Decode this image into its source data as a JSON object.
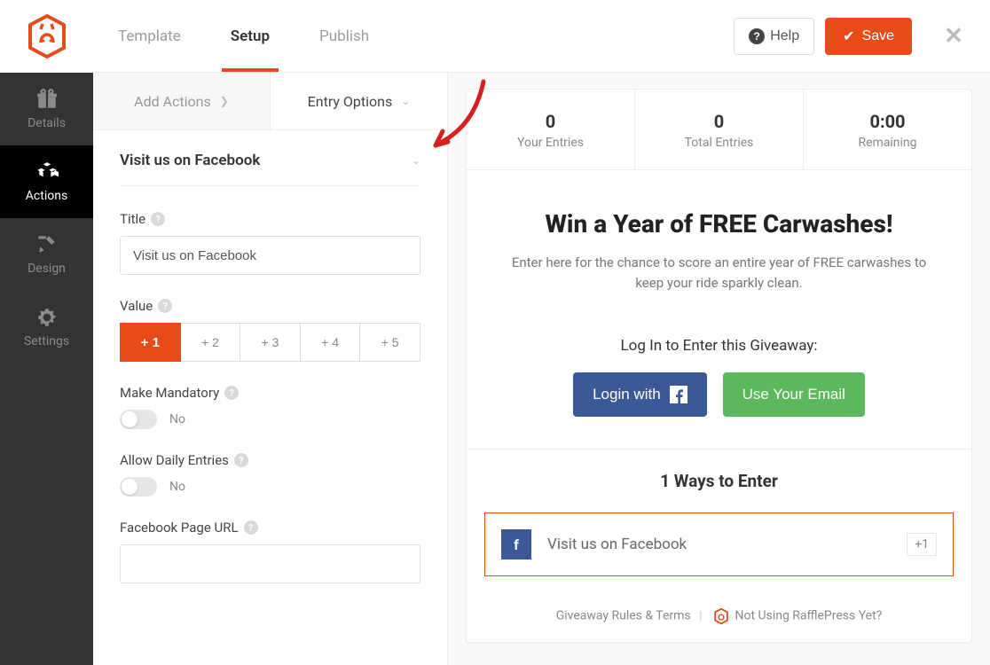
{
  "top": {
    "tabs": {
      "template": "Template",
      "setup": "Setup",
      "publish": "Publish"
    },
    "help": "Help",
    "save": "Save"
  },
  "sidebar": {
    "details": "Details",
    "actions": "Actions",
    "design": "Design",
    "settings": "Settings"
  },
  "subtabs": {
    "add_actions": "Add Actions",
    "entry_options": "Entry Options"
  },
  "panel": {
    "title": "Visit us on Facebook",
    "field_title": "Title",
    "title_value": "Visit us on Facebook",
    "field_value": "Value",
    "values": {
      "v1": "+ 1",
      "v2": "+ 2",
      "v3": "+ 3",
      "v4": "+ 4",
      "v5": "+ 5"
    },
    "make_mandatory": "Make Mandatory",
    "mandatory_state": "No",
    "allow_daily": "Allow Daily Entries",
    "daily_state": "No",
    "fb_url": "Facebook Page URL"
  },
  "preview": {
    "stats": {
      "your_entries_v": "0",
      "your_entries_l": "Your Entries",
      "total_entries_v": "0",
      "total_entries_l": "Total Entries",
      "remaining_v": "0:00",
      "remaining_l": "Remaining"
    },
    "headline": "Win a Year of FREE Carwashes!",
    "subhead": "Enter here for the chance to score an entire year of FREE carwashes to keep your ride sparkly clean.",
    "login_title": "Log In to Enter this Giveaway:",
    "login_fb": "Login with",
    "login_email": "Use Your Email",
    "ways_title": "1 Ways to Enter",
    "entry_label": "Visit us on Facebook",
    "entry_plus": "+1",
    "footer": {
      "rules": "Giveaway Rules & Terms",
      "not_using": "Not Using RafflePress Yet?"
    }
  }
}
